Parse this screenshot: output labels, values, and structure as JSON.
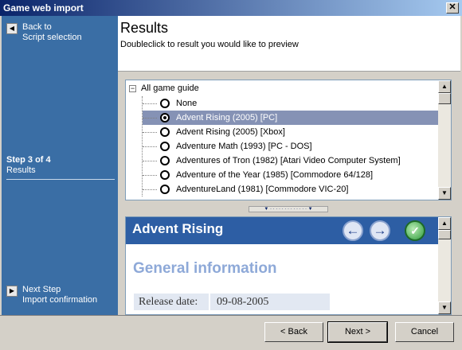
{
  "window": {
    "title": "Game web import",
    "close_glyph": "✕"
  },
  "sidebar": {
    "back": {
      "line1": "Back to",
      "line2": "Script selection",
      "icon": "arrow-left-icon"
    },
    "step": {
      "number": "Step 3 of 4",
      "name": "Results"
    },
    "next": {
      "line1": "Next Step",
      "line2": "Import confirmation",
      "icon": "arrow-right-icon"
    }
  },
  "header": {
    "title": "Results",
    "subtitle": "Doubleclick to result you would like to preview"
  },
  "tree": {
    "root_label": "All game guide",
    "items": [
      {
        "label": "None",
        "checked": false,
        "selected": false
      },
      {
        "label": "Advent Rising (2005) [PC]",
        "checked": true,
        "selected": true
      },
      {
        "label": "Advent Rising (2005) [Xbox]",
        "checked": false,
        "selected": false
      },
      {
        "label": "Adventure Math (1993) [PC - DOS]",
        "checked": false,
        "selected": false
      },
      {
        "label": "Adventures of Tron (1982) [Atari Video Computer System]",
        "checked": false,
        "selected": false
      },
      {
        "label": "Adventure of the Year (1985) [Commodore 64/128]",
        "checked": false,
        "selected": false
      },
      {
        "label": "AdventureLand (1981) [Commodore VIC-20]",
        "checked": false,
        "selected": false
      }
    ]
  },
  "preview": {
    "game_title": "Advent Rising",
    "section_title": "General information",
    "release_label": "Release date:",
    "release_value": "09-08-2005",
    "nav_back_glyph": "←",
    "nav_forward_glyph": "→",
    "globe_glyph": "✓"
  },
  "buttons": {
    "back": "< Back",
    "next": "Next >",
    "cancel": "Cancel"
  },
  "colors": {
    "sidebar": "#3a6ea5",
    "selection": "#8592b5",
    "preview_header": "#2d5ea4"
  }
}
